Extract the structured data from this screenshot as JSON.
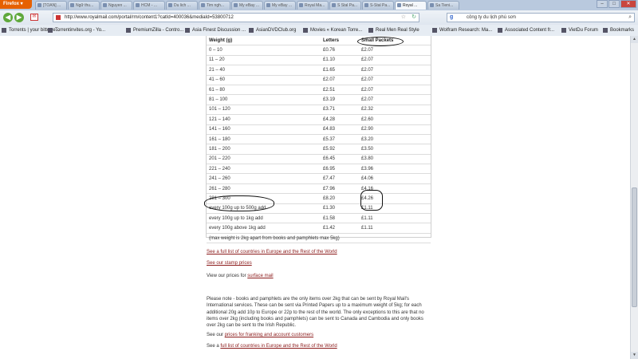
{
  "browser": {
    "menu_label": "Firefox",
    "tabs": [
      "[TOAN] ...",
      "Ngữ thu...",
      "Nguyen ...",
      "HCM - ...",
      "Du lich ...",
      "Tim ngh...",
      "My eBay ...",
      "My eBay ...",
      "Royal Ma...",
      "S Stal Pa...",
      "S-Stal Pa...",
      "Royal ...",
      "Sa Tieni..."
    ],
    "active_tab": "Royal ...",
    "url": "http://www.royalmail.com/portal/rm/content1?catId=400036&mediaId=53800712",
    "search_text": "công ty du lịch phú sơn",
    "bookmarks": [
      "Torrents | your bittorre...",
      "Torrentinvites.org - Yo...",
      "PremiumZilla - Contro...",
      "Asia Finest Discussion ...",
      "AsianDVDClub.org",
      "Movies « Korean Torre...",
      "Real Men Real Style",
      "Wolfram Research: Ma...",
      "Associated Content fr...",
      "VietDu Forum",
      "Bookmarks"
    ]
  },
  "table": {
    "headers": [
      "Weight (g)",
      "Letters",
      "Small Packets"
    ],
    "rows": [
      [
        "0 – 10",
        "£0.76",
        "£2.07"
      ],
      [
        "11 – 20",
        "£1.10",
        "£2.07"
      ],
      [
        "21 – 40",
        "£1.65",
        "£2.07"
      ],
      [
        "41 – 60",
        "£2.07",
        "£2.07"
      ],
      [
        "61 – 80",
        "£2.51",
        "£2.07"
      ],
      [
        "81 – 100",
        "£3.19",
        "£2.07"
      ],
      [
        "101 – 120",
        "£3.71",
        "£2.32"
      ],
      [
        "121 – 140",
        "£4.28",
        "£2.60"
      ],
      [
        "141 – 160",
        "£4.83",
        "£2.90"
      ],
      [
        "161 – 180",
        "£5.37",
        "£3.20"
      ],
      [
        "181 – 200",
        "£5.92",
        "£3.50"
      ],
      [
        "201 – 220",
        "£6.45",
        "£3.80"
      ],
      [
        "221 – 240",
        "£6.95",
        "£3.96"
      ],
      [
        "241 – 260",
        "£7.47",
        "£4.06"
      ],
      [
        "261 – 280",
        "£7.96",
        "£4.16"
      ],
      [
        "281 – 300",
        "£8.20",
        "£4.26"
      ],
      [
        "every 100g up to 500g add",
        "£1.30",
        "£1.11"
      ],
      [
        "every 100g up to 1kg add",
        "£1.58",
        "£1.11"
      ],
      [
        "every 100g above 1kg add",
        "£1.42",
        "£1.11"
      ]
    ],
    "note": "(max weight is 2kg apart from books and pamphlets max 5kg)"
  },
  "links": {
    "europe_link": "See a full list of countries in Europe and the Rest of the World",
    "stamp_prices": "See our stamp prices",
    "surface_prefix": "View our prices for",
    "surface_link": "surface mail"
  },
  "notice": {
    "paragraph": "Please note - books and pamphlets are the only items over 2kg that can be sent by Royal Mail's International services. These can be sent via Printed Papers up to a maximum weight of 5kg; for each additional 20g add 10p to Europe or 22p to the rest of the world. The only exceptions to this are that no items over 2kg (including books and pamphlets) can be sent to Canada and Cambodia and only books over 2kg can be sent to the Irish Republic.",
    "franking_prefix": "See our",
    "franking_link": "prices for franking and account customers",
    "europe_prefix": "See a",
    "europe_link2": "full list of countries in Europe and the Rest of the World"
  }
}
